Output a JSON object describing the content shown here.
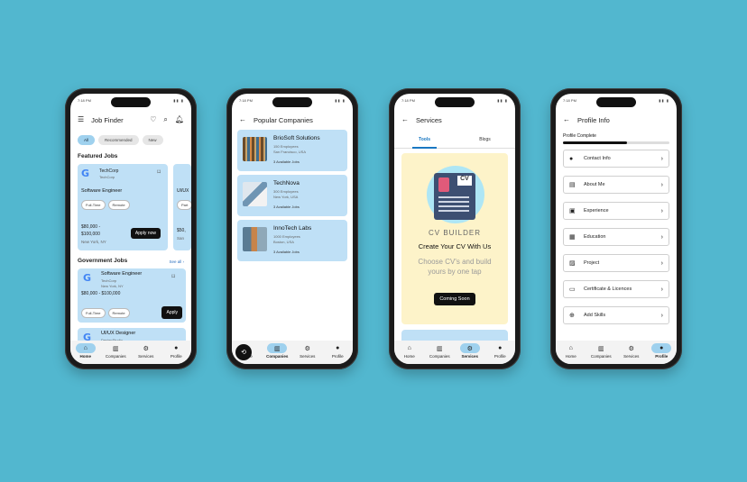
{
  "status_time": "7:18 PM",
  "nav": [
    "Home",
    "Companies",
    "Services",
    "Profile"
  ],
  "phone1": {
    "title": "Job Finder",
    "chips": [
      "All",
      "Recommended",
      "New"
    ],
    "featured_title": "Featured Jobs",
    "featured": {
      "company": "TechCorp",
      "company_sub": "TechCorp",
      "role": "Software Engineer",
      "tags": [
        "Full-Time",
        "Remote"
      ],
      "salary": "$80,000 - $100,000",
      "location": "New York, NY",
      "apply": "Apply now",
      "peek_title": "UI/UX",
      "peek_tag": "Part",
      "peek_salary": "$50,",
      "peek_loc": "San"
    },
    "gov_title": "Government Jobs",
    "see_all": "See all",
    "gov": {
      "role": "Software Engineer",
      "company": "TechCorp",
      "location": "New York, NY",
      "salary": "$80,000 - $100,000",
      "tags": [
        "Full-Time",
        "Remote"
      ],
      "apply": "Apply"
    },
    "gov2": {
      "role": "UI/UX Designer",
      "company": "DesignStudio"
    }
  },
  "phone2": {
    "title": "Popular Companies",
    "companies": [
      {
        "name": "BrioSoft Solutions",
        "employees": "150 Employees",
        "location": "San Francisco, USA",
        "jobs": "3 Available Jobs"
      },
      {
        "name": "TechNova",
        "employees": "300 Employees",
        "location": "New York, USA",
        "jobs": "3 Available Jobs"
      },
      {
        "name": "InnoTech Labs",
        "employees": "1000 Employees",
        "location": "Boston, USA",
        "jobs": "3 Available Jobs"
      }
    ]
  },
  "phone3": {
    "title": "Services",
    "tabs": [
      "Tools",
      "Blogs"
    ],
    "cv_badge": "CV",
    "cv_label": "CV BUILDER",
    "cv_headline": "Create Your CV With Us",
    "cv_sub": "Choose CV's and build yours by one tap",
    "cv_button": "Coming Soon"
  },
  "phone4": {
    "title": "Profile Info",
    "progress_label": "Profile Complete",
    "progress": 0.6,
    "items": [
      "Contact Info",
      "About Me",
      "Experience",
      "Education",
      "Project",
      "Certificate & Licences",
      "Add Skills"
    ]
  }
}
